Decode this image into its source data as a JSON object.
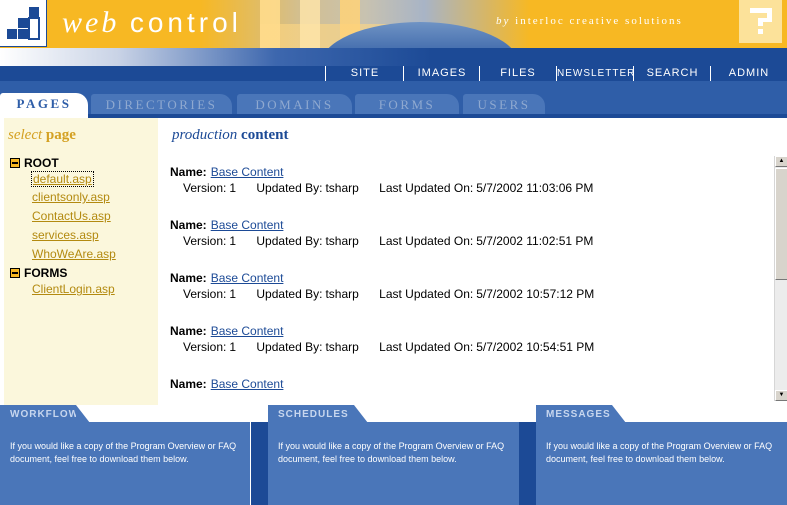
{
  "header": {
    "brand_italic": "web",
    "brand_bold": "control",
    "tagline_italic": "by",
    "tagline": "interloc creative solutions"
  },
  "topnav": {
    "items": [
      "SITE",
      "IMAGES",
      "FILES",
      "NEWSLETTER",
      "SEARCH",
      "ADMIN"
    ]
  },
  "tabs": {
    "items": [
      "PAGES",
      "DIRECTORIES",
      "DOMAINS",
      "FORMS",
      "USERS"
    ],
    "active": "PAGES"
  },
  "sidebar": {
    "title_italic": "select",
    "title_bold": "page",
    "folders": [
      {
        "label": "ROOT",
        "pages": [
          "default.asp",
          "clientsonly.asp",
          "ContactUs.asp",
          "services.asp",
          "WhoWeAre.asp"
        ]
      },
      {
        "label": "FORMS",
        "pages": [
          "ClientLogin.asp"
        ]
      }
    ],
    "selected_page": "default.asp"
  },
  "main": {
    "title_italic": "production",
    "title_bold": "content",
    "labels": {
      "name": "Name:",
      "version": "Version:",
      "updated_by": "Updated By:",
      "last_updated": "Last Updated On:"
    },
    "entries": [
      {
        "name": "Base Content",
        "version": "1",
        "updated_by": "tsharp",
        "last_updated": "5/7/2002 11:03:06 PM"
      },
      {
        "name": "Base Content",
        "version": "1",
        "updated_by": "tsharp",
        "last_updated": "5/7/2002 11:02:51 PM"
      },
      {
        "name": "Base Content",
        "version": "1",
        "updated_by": "tsharp",
        "last_updated": "5/7/2002 10:57:12 PM"
      },
      {
        "name": "Base Content",
        "version": "1",
        "updated_by": "tsharp",
        "last_updated": "5/7/2002 10:54:51 PM"
      },
      {
        "name": "Base Content"
      }
    ]
  },
  "panels": {
    "workflow": {
      "title": "WORKFLOW",
      "text": "If you would like a copy of the Program Overview or FAQ document, feel free to download them below."
    },
    "schedules": {
      "title": "SCHEDULES",
      "text": "If you would like a copy of the Program Overview or FAQ document, feel free to download them below."
    },
    "messages": {
      "title": "MESSAGES",
      "text": "If you would like a copy of the Program Overview or FAQ document, feel free to download them below."
    }
  },
  "colors": {
    "brand_yellow": "#f7b823",
    "brand_blue": "#1c4a96",
    "panel_blue": "#4a76b9",
    "sidebar_bg": "#fbf7dc"
  }
}
